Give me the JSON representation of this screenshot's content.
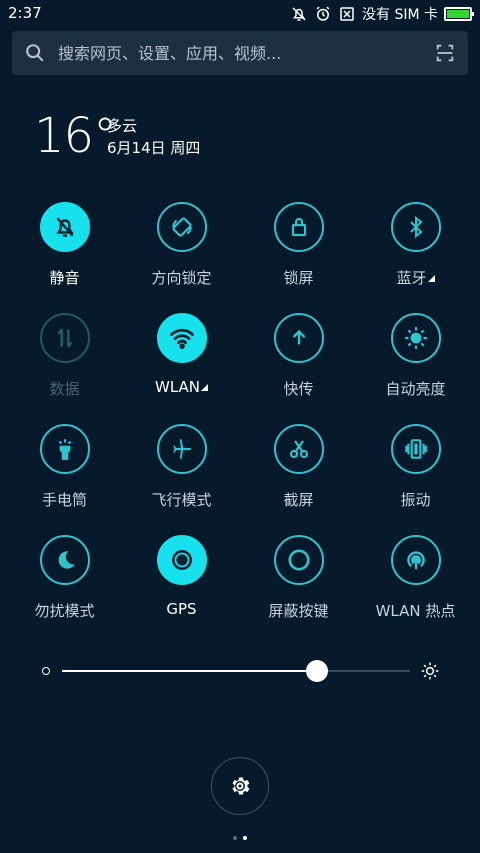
{
  "status_bar": {
    "time": "2:37",
    "sim_text": "没有 SIM 卡",
    "icons": [
      "mute-bell-icon",
      "alarm-icon",
      "no-sim-icon",
      "battery-icon"
    ],
    "battery_color": "#33d633"
  },
  "search": {
    "placeholder": "搜索网页、设置、应用、视频..."
  },
  "weather": {
    "temperature": "16°",
    "condition": "多云",
    "date": "6月14日 周四"
  },
  "toggles": [
    {
      "label": "静音",
      "state": "on",
      "icon": "mute-bell-icon"
    },
    {
      "label": "方向锁定",
      "state": "normal",
      "icon": "rotation-lock-icon"
    },
    {
      "label": "锁屏",
      "state": "normal",
      "icon": "lock-icon"
    },
    {
      "label": "蓝牙",
      "state": "normal",
      "icon": "bluetooth-icon",
      "has_more": true
    },
    {
      "label": "数据",
      "state": "disabled",
      "icon": "data-icon"
    },
    {
      "label": "WLAN",
      "state": "on",
      "icon": "wifi-icon",
      "has_more": true
    },
    {
      "label": "快传",
      "state": "normal",
      "icon": "arrow-up-icon"
    },
    {
      "label": "自动亮度",
      "state": "normal",
      "icon": "auto-brightness-icon"
    },
    {
      "label": "手电筒",
      "state": "normal",
      "icon": "flashlight-icon"
    },
    {
      "label": "飞行模式",
      "state": "normal",
      "icon": "airplane-icon"
    },
    {
      "label": "截屏",
      "state": "normal",
      "icon": "scissors-icon"
    },
    {
      "label": "振动",
      "state": "normal",
      "icon": "vibrate-icon"
    },
    {
      "label": "勿扰模式",
      "state": "normal",
      "icon": "moon-icon"
    },
    {
      "label": "GPS",
      "state": "on",
      "icon": "gps-icon"
    },
    {
      "label": "屏蔽按键",
      "state": "normal",
      "icon": "circle-icon"
    },
    {
      "label": "WLAN 热点",
      "state": "normal",
      "icon": "hotspot-icon"
    }
  ],
  "brightness": {
    "level": 0.734
  },
  "colors": {
    "accent": "#17e1ed",
    "background": "#061a2c"
  },
  "pager": {
    "pages": 2,
    "current": 2
  }
}
